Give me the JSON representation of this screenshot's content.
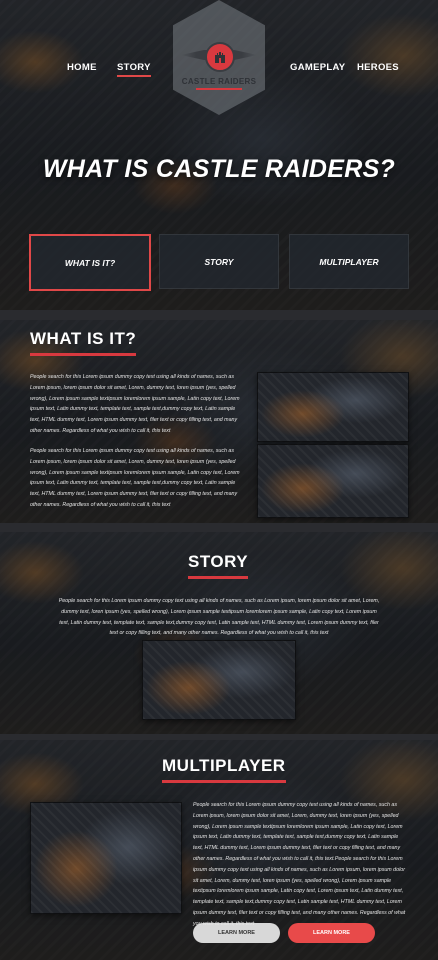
{
  "nav": {
    "home": "HOME",
    "story": "STORY",
    "gameplay": "GAMEPLAY",
    "heroes": "HEROES"
  },
  "logo": {
    "text": "CASTLE RAIDERS"
  },
  "hero": {
    "title": "WHAT IS CASTLE RAIDERS?",
    "tabs": [
      "WHAT IS IT?",
      "STORY",
      "MULTIPLAYER"
    ]
  },
  "whatis": {
    "title": "WHAT IS IT?",
    "paragraphs": [
      "People search for this Lorem ipsum dummy copy text using all kinds of names, such as Lorem ipsum, lorem ipsum dolor sit amet, Lorem, dummy text, loren ipsum (yes, spelled wrong), Lorem ipsum sample textipsum loremlorem ipsum sample, Latin copy text, Lorem ipsum text, Latin dummy text, template text, sample text,dummy copy text, Latin sample text, HTML dummy text, Lorem ipsum dummy text, filer text or copy filling text, and many other names. Regardless of what you wish to call it, this text",
      "People search for this Lorem ipsum dummy copy text using all kinds of names, such as Lorem ipsum, lorem ipsum dolor sit amet, Lorem, dummy text, loren ipsum (yes, spelled wrong), Lorem ipsum sample textipsum loremlorem ipsum sample, Latin copy text, Lorem ipsum text, Latin dummy text, template text, sample text,dummy copy text, Latin sample text, HTML dummy text, Lorem ipsum dummy text, filer text or copy filling text, and many other names. Regardless of what you wish to call it, this text"
    ]
  },
  "story": {
    "title": "STORY",
    "paragraph": "People search for this Lorem ipsum dummy copy text using all kinds of names, such as Lorem ipsum, lorem ipsum dolor sit amet, Lorem, dummy text, loren ipsum (yes, spelled wrong), Lorem ipsum sample textipsum loremlorem ipsum sample, Latin copy text, Lorem ipsum text, Latin dummy text, template text, sample text,dummy copy text, Latin sample text, HTML dummy text, Lorem ipsum dummy text, filer text or copy filling text, and many other names. Regardless of what you wish to call it, this text"
  },
  "multiplayer": {
    "title": "MULTIPLAYER",
    "paragraph": "People search for this Lorem ipsum dummy copy text using all kinds of names, such as Lorem ipsum, lorem ipsum dolor sit amet, Lorem, dummy text, loren ipsum (yes, spelled wrong), Lorem ipsum sample textipsum loremlorem ipsum sample, Latin copy text, Lorem ipsum text, Latin dummy text, template text, sample text,dummy copy text, Latin sample text, HTML dummy text, Lorem ipsum dummy text, filer text or copy filling text, and many other names. Regardless of what you wish to call it, this text.People search for this Lorem ipsum dummy copy text using all kinds of names, such as Lorem ipsum, lorem ipsum dolor sit amet, Lorem, dummy text, loren ipsum (yes, spelled wrong), Lorem ipsum sample textipsum loremlorem ipsum sample, Latin copy text, Lorem ipsum text, Latin dummy text, template text, sample text,dummy copy text, Latin sample text, HTML dummy text, Lorem ipsum dummy text, filer text or copy filling text, and many other names. Regardless of what you wish to call it, this text",
    "buttons": {
      "learn_more_1": "LEARN MORE",
      "learn_more_2": "LEARN MORE"
    }
  },
  "colors": {
    "accent": "#d8393f",
    "button_gray": "#d8d8d8",
    "button_red": "#e84a4a"
  }
}
